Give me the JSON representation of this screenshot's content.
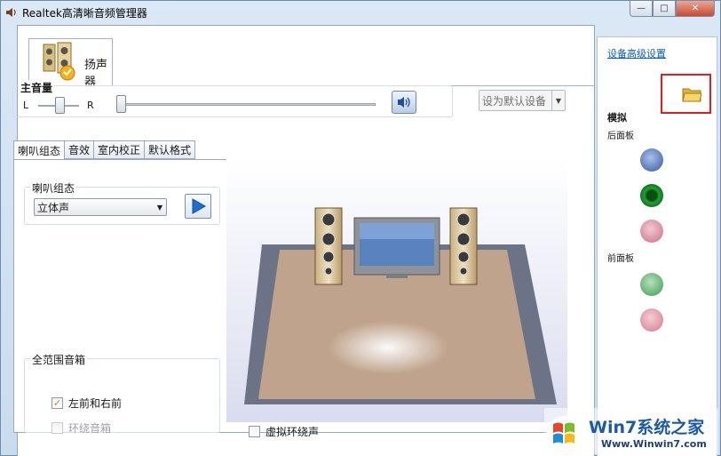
{
  "window": {
    "title": "Realtek高清晰音频管理器",
    "controls": {
      "minimize": "—",
      "maximize": "□",
      "close": "✕"
    }
  },
  "device_tab": {
    "label": "扬声器",
    "icon": "speaker-icon"
  },
  "volume": {
    "label": "主音量",
    "balance_left": "L",
    "balance_right": "R",
    "balance_level": 0.5,
    "volume_level": 0.0,
    "mute_icon": "speaker-volume-icon"
  },
  "default_device": {
    "label": "设为默认设备"
  },
  "sub_tabs": [
    {
      "label": "喇叭组态",
      "active": true
    },
    {
      "label": "音效",
      "active": false
    },
    {
      "label": "室内校正",
      "active": false
    },
    {
      "label": "默认格式",
      "active": false
    }
  ],
  "speaker_config": {
    "group_label": "喇叭组态",
    "selected": "立体声",
    "play_icon": "play-icon"
  },
  "full_range": {
    "group_label": "全范围音箱",
    "front": {
      "label": "左前和右前",
      "checked": true,
      "enabled": true
    },
    "surround": {
      "label": "环绕音箱",
      "checked": false,
      "enabled": false
    }
  },
  "virtual_surround": {
    "label": "虚拟环绕声",
    "checked": false
  },
  "right_panel": {
    "advanced_link": "设备高级设置",
    "folder_icon": "folder-icon",
    "analog_heading": "模拟",
    "back_panel": "后面板",
    "front_panel": "前面板",
    "back_jacks": [
      {
        "name": "blue-jack",
        "color": "#6b8fcf"
      },
      {
        "name": "green-jack",
        "color": "#1a9a2e"
      },
      {
        "name": "pink-jack",
        "color": "#e29aac"
      }
    ],
    "front_jacks": [
      {
        "name": "green-jack",
        "color": "#6fbf7c"
      },
      {
        "name": "pink-jack",
        "color": "#e9a3b1"
      }
    ]
  },
  "watermark": {
    "title": "Win7系统之家",
    "url": "Www.Winwin7.com"
  }
}
